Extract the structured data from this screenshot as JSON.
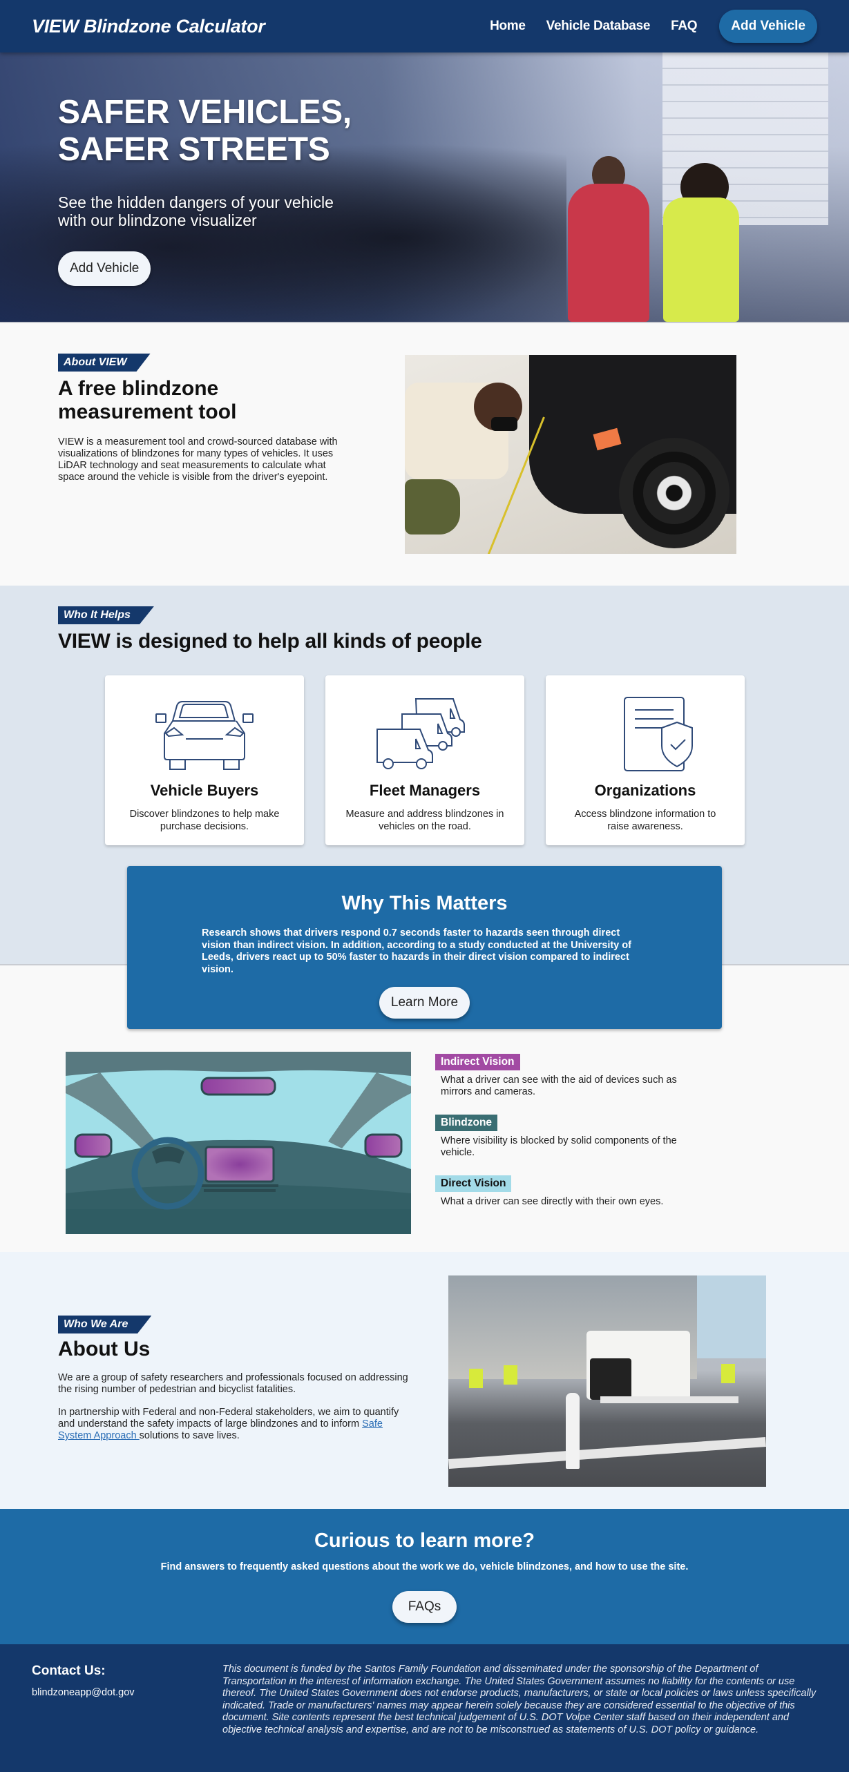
{
  "nav": {
    "brand": "VIEW Blindzone Calculator",
    "links": [
      "Home",
      "Vehicle Database",
      "FAQ"
    ],
    "cta": "Add Vehicle"
  },
  "hero": {
    "title_line1": "SAFER VEHICLES,",
    "title_line2": "SAFER STREETS",
    "subtitle": "See the hidden dangers of your vehicle with our blindzone visualizer",
    "button": "Add Vehicle"
  },
  "about_view": {
    "tag": "About VIEW",
    "title": "A free blindzone measurement tool",
    "body": "VIEW is a measurement tool and crowd-sourced database with visualizations of blindzones for many types of vehicles. It uses LiDAR technology and seat measurements to calculate what space around the vehicle is visible from the driver's eyepoint."
  },
  "who_it_helps": {
    "tag": "Who It Helps",
    "title": "VIEW is designed to help all kinds of people",
    "cards": [
      {
        "icon": "car-front-icon",
        "title": "Vehicle Buyers",
        "desc": "Discover blindzones to help make purchase decisions."
      },
      {
        "icon": "van-fleet-icon",
        "title": "Fleet Managers",
        "desc": "Measure and address blindzones in vehicles on the road."
      },
      {
        "icon": "document-shield-icon",
        "title": "Organizations",
        "desc": "Access blindzone information to raise awareness."
      }
    ]
  },
  "why_matters": {
    "title": "Why This Matters",
    "body": "Research shows that drivers respond 0.7 seconds faster to hazards seen through direct vision than indirect vision. In addition, according to a study conducted at the University of Leeds, drivers react up to 50% faster to hazards in their direct vision compared to indirect vision.",
    "button": "Learn More"
  },
  "definitions": [
    {
      "label": "Indirect Vision",
      "text": "What a driver can see with the aid of devices such as mirrors and cameras.",
      "bg": "#a24aa3",
      "fg": "#ffffff"
    },
    {
      "label": "Blindzone",
      "text": "Where visibility is blocked by solid components of the vehicle.",
      "bg": "#3a6e73",
      "fg": "#ffffff"
    },
    {
      "label": "Direct Vision",
      "text": "What a driver can see directly with their own eyes.",
      "bg": "#a3dbe8",
      "fg": "#111111"
    }
  ],
  "about_us": {
    "tag": "Who We Are",
    "title": "About Us",
    "p1": "We are a group of safety researchers and professionals focused on addressing the rising number of pedestrian and bicyclist fatalities.",
    "p2_before": "In partnership with Federal and non-Federal stakeholders, we aim to quantify and understand the safety impacts of large blindzones and to inform ",
    "p2_link": "Safe System Approach ",
    "p2_after": "solutions to save lives."
  },
  "cta": {
    "title": "Curious to learn more?",
    "subtitle": "Find answers to frequently asked questions about the work we do, vehicle blindzones, and how to use the site.",
    "button": "FAQs"
  },
  "footer": {
    "contact_title": "Contact Us:",
    "email": "blindzoneapp@dot.gov",
    "disclaimer": "This document is funded by the Santos Family Foundation and disseminated under the sponsorship of the Department of Transportation in the interest of information exchange. The United States Government assumes no liability for the contents or use thereof. The United States Government does not endorse products, manufacturers, or state or local policies or laws unless specifically indicated. Trade or manufacturers' names may appear herein solely because they are considered essential to the objective of this document. Site contents represent the best technical judgement of U.S. DOT Volpe Center staff based on their independent and objective technical analysis and expertise, and are not to be misconstrued as statements of U.S. DOT policy or guidance."
  },
  "colors": {
    "navy": "#14386b",
    "accent_blue": "#1e6ba6",
    "helps_bg": "#dde5ee",
    "about_us_bg": "#eef4fa"
  }
}
